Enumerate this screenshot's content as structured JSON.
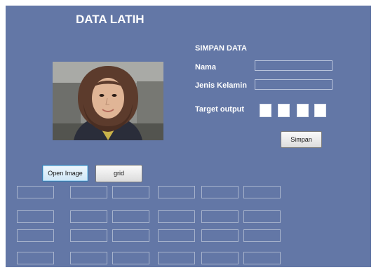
{
  "window": {
    "title": "DATA LATIH"
  },
  "form": {
    "section_title": "SIMPAN DATA",
    "nama_label": "Nama",
    "nama_value": "",
    "jenis_kelamin_label": "Jenis Kelamin",
    "jenis_kelamin_value": "",
    "target_output_label": "Target output",
    "target_boxes": 4,
    "save_label": "Simpan"
  },
  "buttons": {
    "open_image_label": "Open Image",
    "grid_label": "grid"
  },
  "grid": {
    "rows": 4,
    "cols": 6
  },
  "colors": {
    "background": "#6377a6",
    "text": "#ffffff"
  }
}
